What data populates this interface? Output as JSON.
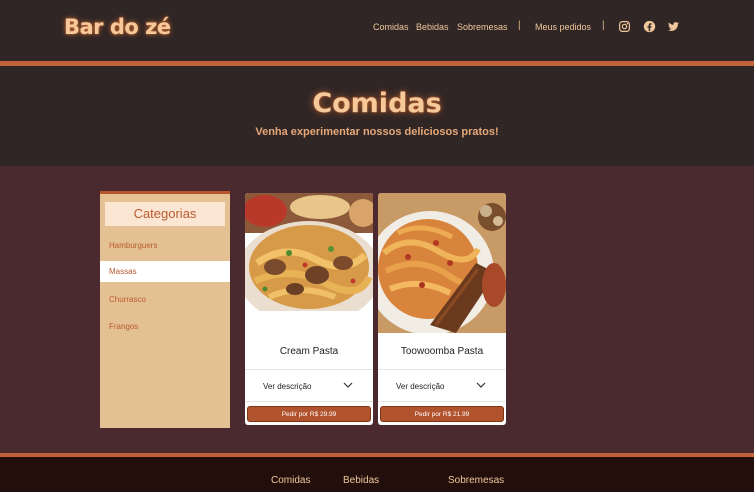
{
  "header": {
    "logo": "Bar do zé",
    "nav": [
      "Comidas",
      "Bebidas",
      "Sobremesas"
    ],
    "orders": "Meus pedidos",
    "separator": "|",
    "social_icons": [
      "instagram-icon",
      "facebook-icon",
      "twitter-icon"
    ]
  },
  "hero": {
    "title": "Comidas",
    "subtitle": "Venha experimentar nossos deliciosos pratos!"
  },
  "sidebar": {
    "title": "Categorias",
    "items": [
      "Hamburguers",
      "Massas",
      "Churrasco",
      "Frangos"
    ],
    "active": "Massas"
  },
  "products": [
    {
      "name": "Cream Pasta",
      "desc_label": "Ver descrição",
      "button": "Pedir por R$ 29.99"
    },
    {
      "name": "Toowoomba Pasta",
      "desc_label": "Ver descrição",
      "button": "Pedir por R$ 21.99"
    }
  ],
  "footer": {
    "links": [
      "Comidas",
      "Bebidas",
      "Sobremesas"
    ]
  },
  "colors": {
    "accent": "#c0633a",
    "header_bg": "#302626",
    "body_bg": "#4a2a2e",
    "logo": "#f6c99b",
    "sidebar_bg": "#e4c192",
    "button": "#b1532d"
  }
}
